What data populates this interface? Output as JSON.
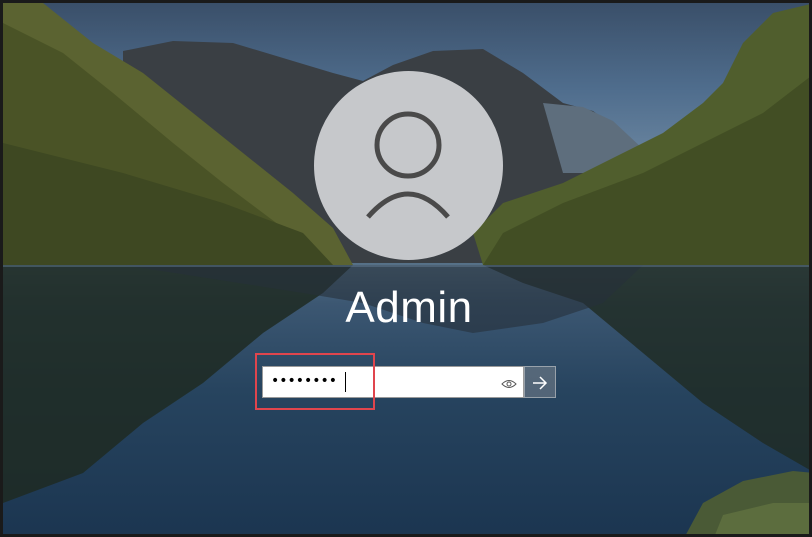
{
  "login": {
    "username": "Admin",
    "password_masked": "••••••••"
  },
  "icons": {
    "avatar": "user-avatar-icon",
    "reveal": "eye-icon",
    "submit": "arrow-right-icon"
  },
  "colors": {
    "highlight": "#e0454d",
    "avatar_bg": "#c6c8cb"
  }
}
